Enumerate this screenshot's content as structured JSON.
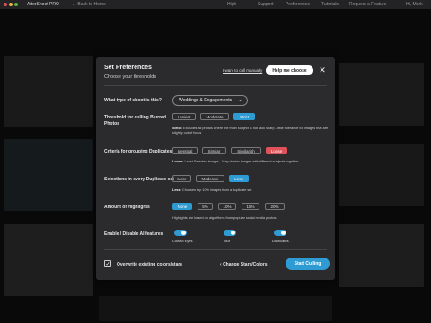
{
  "app": {
    "name": "AfterShoot PRO",
    "back_link": "← Back to Home",
    "quality": "High",
    "support": "Support",
    "preferences": "Preferences",
    "tutorials": "Tutorials",
    "request_feature": "Request a Feature",
    "greeting": "Hi, Mark"
  },
  "colors": {
    "accent": "#2e9bd3",
    "danger": "#e0525a",
    "modal_bg": "#2b2b2d"
  },
  "modal": {
    "title": "Set Preferences",
    "subtitle": "Choose your thresholds",
    "cull_manually": "I want to cull manually",
    "help_label": "Help me choose",
    "close_icon": "close-icon",
    "shoot_type": {
      "label": "What type of shoot is this?",
      "value": "Weddings & Engagements"
    },
    "threshold": {
      "label_line1": "Threshold for culling Blurred",
      "label_line2": "Photos",
      "options": [
        "Lenient",
        "Moderate",
        "Strict"
      ],
      "selected": "Strict",
      "note_bold": "Strict:",
      "note_text": "Excludes all photos where the main subject is not tack sharp - little tolerance for images that are slightly out of focus"
    },
    "grouping": {
      "label": "Criteria for grouping Duplicates",
      "options": [
        "Identical",
        "Similar",
        "Similarish",
        "Loose"
      ],
      "selected": "Loose",
      "note_bold": "Loose:",
      "note_text": "Least Selected images - May cluster images with different subjects together"
    },
    "selections": {
      "label": "Selections in every Duplicate set",
      "options": [
        "More",
        "Moderate",
        "Less"
      ],
      "selected": "Less",
      "note_bold": "Less:",
      "note_text": "Chooses top 10% images from a duplicate set"
    },
    "highlights": {
      "label": "Amount of Highlights",
      "options": [
        "None",
        "5%",
        "10%",
        "15%",
        "20%"
      ],
      "selected": "None",
      "note_text": "Highlights are based on algorithms from popular social media photos."
    },
    "ai_features": {
      "label": "Enable / Disable AI features",
      "toggles": [
        {
          "label": "Closed Eyes",
          "on": true
        },
        {
          "label": "Blur",
          "on": true
        },
        {
          "label": "Duplicates",
          "on": true
        }
      ]
    },
    "footer": {
      "overwrite_label": "Overwrite existing colors/stars",
      "overwrite_checked": true,
      "change_label": "Change Stars/Colors",
      "start_label": "Start Culling"
    }
  }
}
